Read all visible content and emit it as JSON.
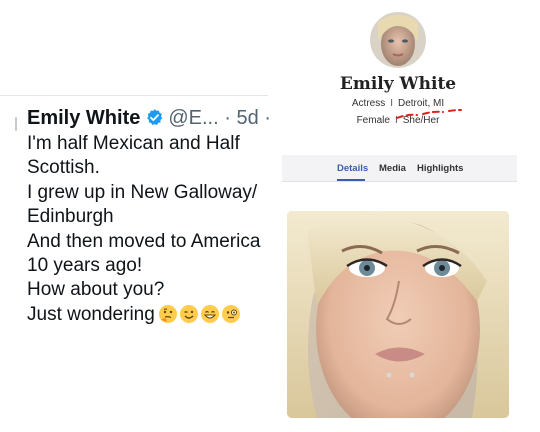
{
  "tweet": {
    "name": "Emily White",
    "handle": "@E...",
    "dot": "·",
    "age": "5d",
    "dot2": "·",
    "lines": [
      "I'm half Mexican and Half",
      "Scottish.",
      "I grew up in New Galloway/",
      "Edinburgh",
      "And then moved to America",
      "10 years ago!",
      "How about you?",
      "Just wondering"
    ],
    "emojis": [
      "thinking-face",
      "winking-face",
      "grinning-face",
      "face-with-monocle"
    ],
    "icons": {
      "verified": "verified-badge-icon",
      "more": "grok-icon"
    },
    "colors": {
      "verified": "#1d9bf0",
      "text": "#0f1419",
      "muted": "#536471"
    }
  },
  "profile": {
    "name": "Emily White",
    "occupation": "Actress",
    "separator": "I",
    "location": "Detroit, MI",
    "gender": "Female",
    "pronouns": "She/Her",
    "tabs": [
      {
        "label": "Details",
        "active": true
      },
      {
        "label": "Media",
        "active": false
      },
      {
        "label": "Highlights",
        "active": false
      }
    ],
    "colors": {
      "active_tab": "#3a5dae",
      "annotation": "#e0201e"
    }
  }
}
